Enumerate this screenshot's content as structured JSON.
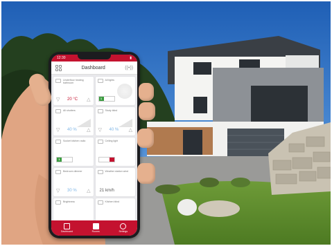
{
  "phone": {
    "status_time": "12:30",
    "app_title": "Dashboard",
    "tiles": [
      {
        "label": "Underfloor heating bathroom",
        "value": "20 °C",
        "kind": "stepper",
        "color": "red"
      },
      {
        "label": "All lights",
        "value": "1",
        "kind": "toggle-on"
      },
      {
        "label": "All shutters",
        "value": "40 %",
        "kind": "stepper",
        "color": "blue"
      },
      {
        "label": "Study blind",
        "value": "40 %",
        "kind": "stepper",
        "color": "blue"
      },
      {
        "label": "Socket kitchen radio",
        "value": "1",
        "kind": "toggle-on"
      },
      {
        "label": "Ceiling light",
        "value": "0",
        "kind": "toggle-off"
      },
      {
        "label": "Bedroom dimmer",
        "value": "30 %",
        "kind": "stepper",
        "color": "blue"
      },
      {
        "label": "Weather station wind",
        "value": "21 km/h",
        "kind": "readout"
      },
      {
        "label": "Brightness",
        "value": "",
        "kind": "readout"
      },
      {
        "label": "Kitchen blind",
        "value": "",
        "kind": "readout"
      }
    ],
    "nav": [
      {
        "label": "Dashboard",
        "icon": "grid-icon"
      },
      {
        "label": "Rooms",
        "icon": "house-icon"
      },
      {
        "label": "Settings",
        "icon": "gear-icon"
      }
    ]
  },
  "colors": {
    "brand_red": "#c4122f",
    "sky": "#2d6fc0",
    "lawn": "#5f8d2f"
  }
}
